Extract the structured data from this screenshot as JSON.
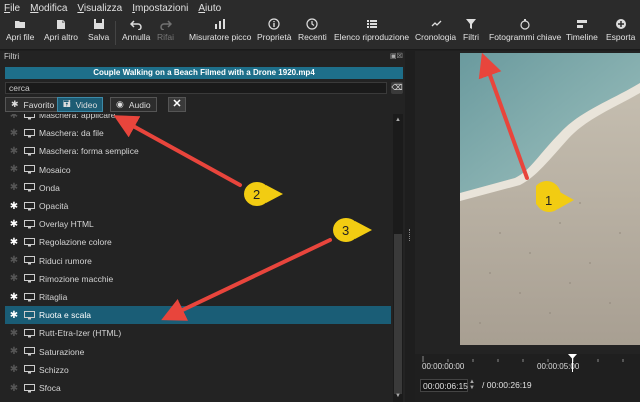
{
  "menu": [
    "File",
    "Modifica",
    "Visualizza",
    "Impostazioni",
    "Aiuto"
  ],
  "toolbar": {
    "open": "Apri file",
    "open_other": "Apri altro",
    "save": "Salva",
    "undo": "Annulla",
    "redo": "Rifai",
    "peak": "Misuratore picco",
    "properties": "Proprietà",
    "recent": "Recenti",
    "playlist": "Elenco riproduzione",
    "history": "Cronologia",
    "filters": "Filtri",
    "keyframes": "Fotogrammi chiave",
    "timeline": "Timeline",
    "export": "Esporta"
  },
  "filters_panel": {
    "title": "Filtri",
    "clip_name": "Couple Walking on a Beach Filmed with a Drone 1920.mp4",
    "search_value": "cerca",
    "tabs": {
      "favorite": "Favorito",
      "video": "Video",
      "audio": "Audio"
    },
    "items": [
      {
        "label": "Maschera: applicare",
        "favorite": false
      },
      {
        "label": "Maschera: da file",
        "favorite": false
      },
      {
        "label": "Maschera: forma semplice",
        "favorite": false
      },
      {
        "label": "Mosaico",
        "favorite": false
      },
      {
        "label": "Onda",
        "favorite": false
      },
      {
        "label": "Opacità",
        "favorite": true
      },
      {
        "label": "Overlay HTML",
        "favorite": true
      },
      {
        "label": "Regolazione colore",
        "favorite": true
      },
      {
        "label": "Riduci rumore",
        "favorite": false
      },
      {
        "label": "Rimozione macchie",
        "favorite": false
      },
      {
        "label": "Ritaglia",
        "favorite": true
      },
      {
        "label": "Ruota e scala",
        "favorite": true,
        "selected": true
      },
      {
        "label": "Rutt-Etra-Izer (HTML)",
        "favorite": false
      },
      {
        "label": "Saturazione",
        "favorite": false
      },
      {
        "label": "Schizzo",
        "favorite": false
      },
      {
        "label": "Sfoca",
        "favorite": false
      }
    ]
  },
  "player": {
    "ruler_start": "00:00:00:00",
    "ruler_mid": "00:00:05:00",
    "position": "00:00:06:15",
    "duration": "/ 00:00:26:19"
  },
  "annotations": {
    "n1": "1",
    "n2": "2",
    "n3": "3"
  },
  "colors": {
    "accent": "#1d5c74",
    "clip_bar": "#1e6f8a",
    "arrow": "#e8453c",
    "bubble": "#f2cc12"
  }
}
